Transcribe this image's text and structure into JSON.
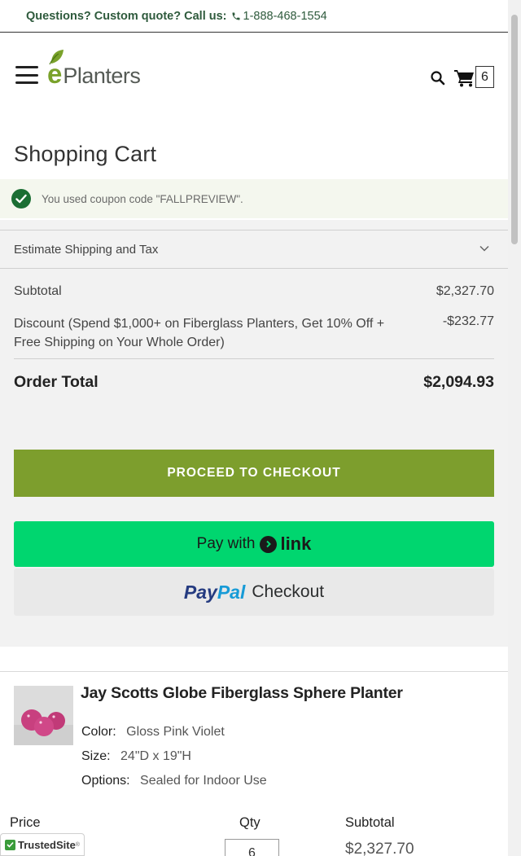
{
  "topbar": {
    "question": "Questions? Custom quote? Call us:",
    "phone": "1-888-468-1554"
  },
  "header": {
    "logo_e": "e",
    "logo_word": "Planters",
    "cart_count": "6"
  },
  "page": {
    "title": "Shopping Cart"
  },
  "notice": {
    "message": "You used coupon code \"FALLPREVIEW\"."
  },
  "summary": {
    "shipping_label": "Estimate Shipping and Tax",
    "subtotal_label": "Subtotal",
    "subtotal_value": "$2,327.70",
    "discount_label": "Discount (Spend $1,000+ on Fiberglass Planters, Get 10% Off + Free Shipping on Your Whole Order)",
    "discount_value": "-$232.77",
    "order_total_label": "Order Total",
    "order_total_value": "$2,094.93",
    "checkout_label": "PROCEED TO CHECKOUT",
    "link_pay_with": "Pay with",
    "link_word": "link",
    "paypal_p1": "Pay",
    "paypal_p2": "Pal",
    "paypal_checkout": "Checkout"
  },
  "item": {
    "name": "Jay Scotts Globe Fiberglass Sphere Planter",
    "color_label": "Color:",
    "color_value": "Gloss Pink Violet",
    "size_label": "Size:",
    "size_value": "24\"D x 19\"H",
    "options_label": "Options:",
    "options_value": "Sealed for Indoor Use",
    "price_header": "Price",
    "qty_header": "Qty",
    "subtotal_header": "Subtotal",
    "qty_value": "6",
    "row_subtotal": "$2,327.70"
  },
  "badge": {
    "trusted": "TrustedSite",
    "tm": "®"
  },
  "colors": {
    "brand_green": "#7d9e2d",
    "link_green": "#00d66f",
    "dark_green": "#1b6e33",
    "paypal_blue_dark": "#253b80",
    "paypal_blue_light": "#179bd7",
    "product_pink": "#c8407f"
  }
}
